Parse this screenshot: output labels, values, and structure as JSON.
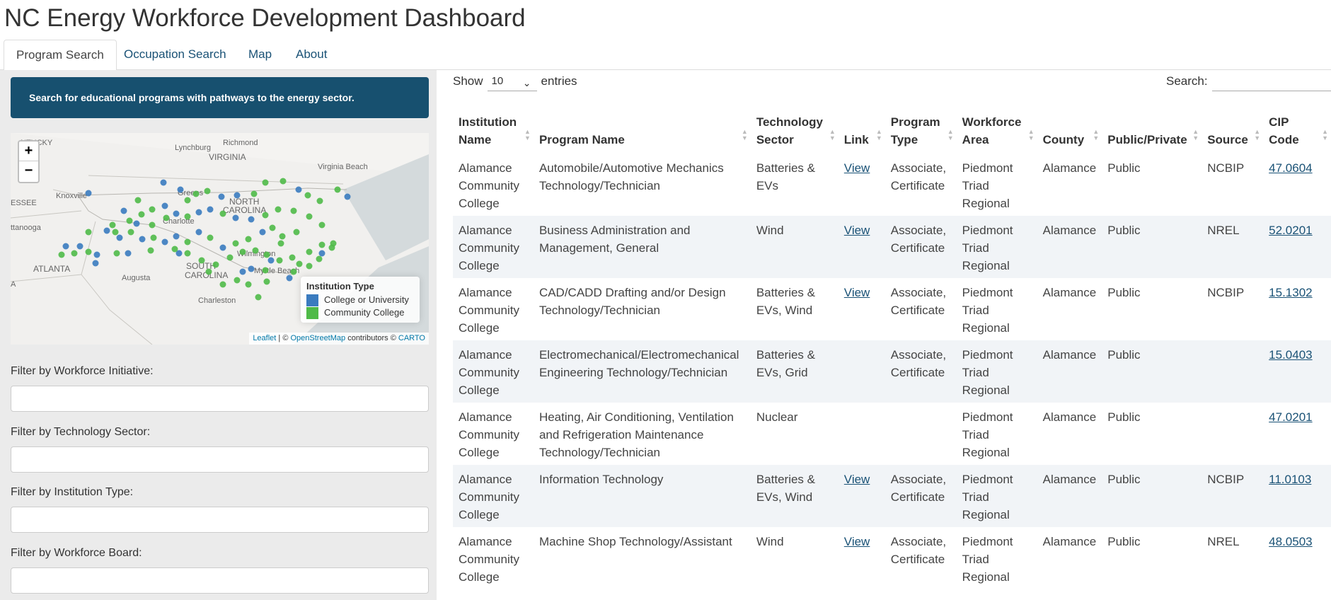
{
  "app": {
    "title": "NC Energy Workforce Development Dashboard"
  },
  "tabs": [
    {
      "label": "Program Search",
      "active": true
    },
    {
      "label": "Occupation Search",
      "active": false
    },
    {
      "label": "Map",
      "active": false
    },
    {
      "label": "About",
      "active": false
    }
  ],
  "sidebar": {
    "banner": "Search for educational programs with pathways to the energy sector.",
    "map": {
      "zoom_in": "+",
      "zoom_out": "−",
      "place_labels": [
        "NTUCKY",
        "Richmond",
        "Lynchburg",
        "VIRGINIA",
        "Virginia Beach",
        "Knoxville",
        "Greens",
        "NORTH",
        "CAROLINA",
        "ESSEE",
        "Charlotte",
        "ttanooga",
        "Wilmington",
        "ATLANTA",
        "SOUTH",
        "CAROLINA",
        "Augusta",
        "Myrtle Beach",
        "Charleston",
        "A"
      ],
      "legend": {
        "title": "Institution Type",
        "items": [
          {
            "label": "College or University",
            "color": "#3a7bbf"
          },
          {
            "label": "Community College",
            "color": "#4fba48"
          }
        ]
      },
      "attribution": {
        "leaflet": "Leaflet",
        "sep1": " | © ",
        "osm": "OpenStreetMap",
        "mid": " contributors © ",
        "carto": "CARTO"
      }
    },
    "filters": [
      {
        "label": "Filter by Workforce Initiative:",
        "value": ""
      },
      {
        "label": "Filter by Technology Sector:",
        "value": ""
      },
      {
        "label": "Filter by Institution Type:",
        "value": ""
      },
      {
        "label": "Filter by Workforce Board:",
        "value": ""
      }
    ]
  },
  "table_controls": {
    "show_label": "Show",
    "page_length": "10",
    "entries_label": "entries",
    "search_label": "Search:",
    "search_value": ""
  },
  "table": {
    "headers": [
      "Institution Name",
      "Program Name",
      "Technology Sector",
      "Link",
      "Program Type",
      "Workforce Area",
      "County",
      "Public/Private",
      "Source",
      "CIP Code"
    ],
    "rows": [
      [
        "Alamance Community College",
        "Automobile/Automotive Mechanics Technology/Technician",
        "Batteries & EVs",
        "View",
        "Associate, Certificate",
        "Piedmont Triad Regional",
        "Alamance",
        "Public",
        "NCBIP",
        "47.0604"
      ],
      [
        "Alamance Community College",
        "Business Administration and Management, General",
        "Wind",
        "View",
        "Associate, Certificate",
        "Piedmont Triad Regional",
        "Alamance",
        "Public",
        "NREL",
        "52.0201"
      ],
      [
        "Alamance Community College",
        "CAD/CADD Drafting and/or Design Technology/Technician",
        "Batteries & EVs, Wind",
        "View",
        "Associate, Certificate",
        "Piedmont Triad Regional",
        "Alamance",
        "Public",
        "NCBIP",
        "15.1302"
      ],
      [
        "Alamance Community College",
        "Electromechanical/Electromechanical Engineering Technology/Technician",
        "Batteries & EVs, Grid",
        "",
        "Associate, Certificate",
        "Piedmont Triad Regional",
        "Alamance",
        "Public",
        "",
        "15.0403"
      ],
      [
        "Alamance Community College",
        "Heating, Air Conditioning, Ventilation and Refrigeration Maintenance Technology/Technician",
        "Nuclear",
        "",
        "",
        "Piedmont Triad Regional",
        "Alamance",
        "Public",
        "",
        "47.0201"
      ],
      [
        "Alamance Community College",
        "Information Technology",
        "Batteries & EVs, Wind",
        "View",
        "Associate, Certificate",
        "Piedmont Triad Regional",
        "Alamance",
        "Public",
        "NCBIP",
        "11.0103"
      ],
      [
        "Alamance Community College",
        "Machine Shop Technology/Assistant",
        "Wind",
        "View",
        "Associate, Certificate",
        "Piedmont Triad Regional",
        "Alamance",
        "Public",
        "NREL",
        "48.0503"
      ]
    ]
  }
}
